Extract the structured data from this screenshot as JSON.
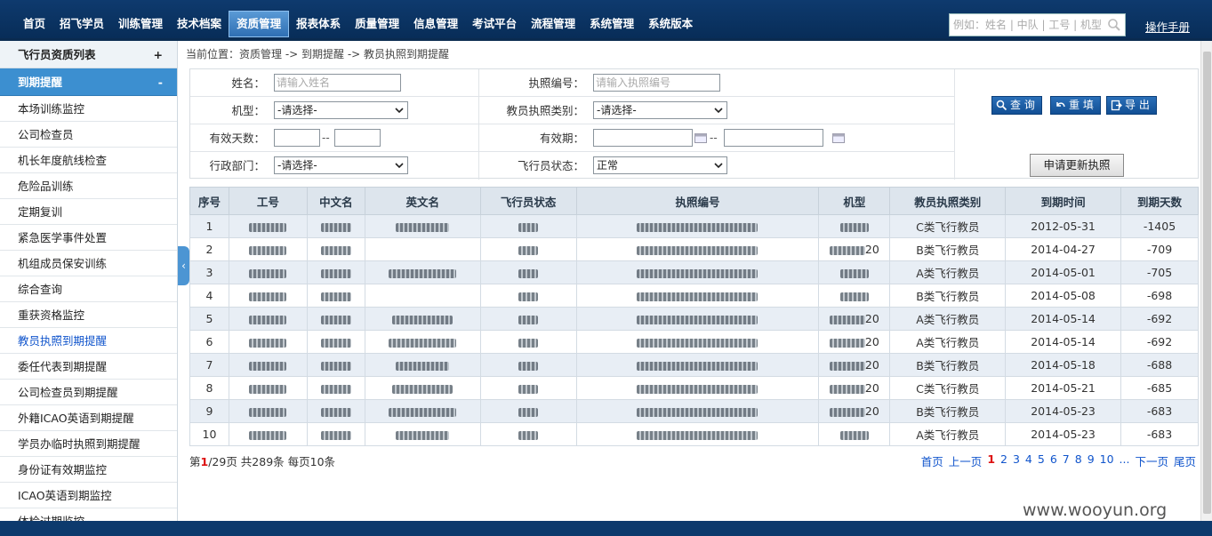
{
  "nav": {
    "items": [
      "首页",
      "招飞学员",
      "训练管理",
      "技术档案",
      "资质管理",
      "报表体系",
      "质量管理",
      "信息管理",
      "考试平台",
      "流程管理",
      "系统管理",
      "系统版本"
    ],
    "active_index": 4,
    "search_placeholder": "例如：姓名 | 中队 | 工号 | 机型",
    "manual": "操作手册"
  },
  "sidebar": {
    "group1": {
      "label": "飞行员资质列表",
      "sign": "+"
    },
    "group2": {
      "label": "到期提醒",
      "sign": "-"
    },
    "items": [
      "本场训练监控",
      "公司检查员",
      "机长年度航线检查",
      "危险品训练",
      "定期复训",
      "紧急医学事件处置",
      "机组成员保安训练",
      "综合查询",
      "重获资格监控",
      "教员执照到期提醒",
      "委任代表到期提醒",
      "公司检查员到期提醒",
      "外籍ICAO英语到期提醒",
      "学员办临时执照到期提醒",
      "身份证有效期监控",
      "ICAO英语到期监控",
      "体检过期监控"
    ],
    "current_index": 9
  },
  "breadcrumb": "当前位置：资质管理 -> 到期提醒 -> 教员执照到期提醒",
  "form": {
    "name_label": "姓名：",
    "name_placeholder": "请输入姓名",
    "license_label": "执照编号：",
    "license_placeholder": "请输入执照编号",
    "type_label": "机型：",
    "type_value": "-请选择-",
    "category_label": "教员执照类别：",
    "category_value": "-请选择-",
    "days_label": "有效天数：",
    "range_sep": "--",
    "valid_label": "有效期：",
    "dept_label": "行政部门：",
    "dept_value": "-请选择-",
    "status_label": "飞行员状态：",
    "status_value": "正常"
  },
  "buttons": {
    "query": "查 询",
    "reset": "重 填",
    "export": "导 出",
    "renew": "申请更新执照"
  },
  "table": {
    "headers": [
      "序号",
      "工号",
      "中文名",
      "英文名",
      "飞行员状态",
      "执照编号",
      "机型",
      "教员执照类别",
      "到期时间",
      "到期天数"
    ],
    "rows": [
      {
        "no": "1",
        "type_suffix": "",
        "category": "C类飞行教员",
        "date": "2012-05-31",
        "days": "-1405"
      },
      {
        "no": "2",
        "type_suffix": "20",
        "category": "B类飞行教员",
        "date": "2014-04-27",
        "days": "-709"
      },
      {
        "no": "3",
        "type_suffix": "",
        "category": "A类飞行教员",
        "date": "2014-05-01",
        "days": "-705"
      },
      {
        "no": "4",
        "type_suffix": "",
        "category": "B类飞行教员",
        "date": "2014-05-08",
        "days": "-698"
      },
      {
        "no": "5",
        "type_suffix": "20",
        "category": "A类飞行教员",
        "date": "2014-05-14",
        "days": "-692"
      },
      {
        "no": "6",
        "type_suffix": "20",
        "category": "A类飞行教员",
        "date": "2014-05-14",
        "days": "-692"
      },
      {
        "no": "7",
        "type_suffix": "20",
        "category": "B类飞行教员",
        "date": "2014-05-18",
        "days": "-688"
      },
      {
        "no": "8",
        "type_suffix": "20",
        "category": "C类飞行教员",
        "date": "2014-05-21",
        "days": "-685"
      },
      {
        "no": "9",
        "type_suffix": "20",
        "category": "B类飞行教员",
        "date": "2014-05-23",
        "days": "-683"
      },
      {
        "no": "10",
        "type_suffix": "",
        "category": "A类飞行教员",
        "date": "2014-05-23",
        "days": "-683"
      }
    ]
  },
  "pager": {
    "prefix": "第",
    "current": "1",
    "suffix": "/29页 共289条 每页10条",
    "first": "首页",
    "prev": "上一页",
    "pages": [
      "1",
      "2",
      "3",
      "4",
      "5",
      "6",
      "7",
      "8",
      "9",
      "10"
    ],
    "ellipsis": "...",
    "next": "下一页",
    "last": "尾页"
  },
  "watermark": "www.wooyun.org"
}
